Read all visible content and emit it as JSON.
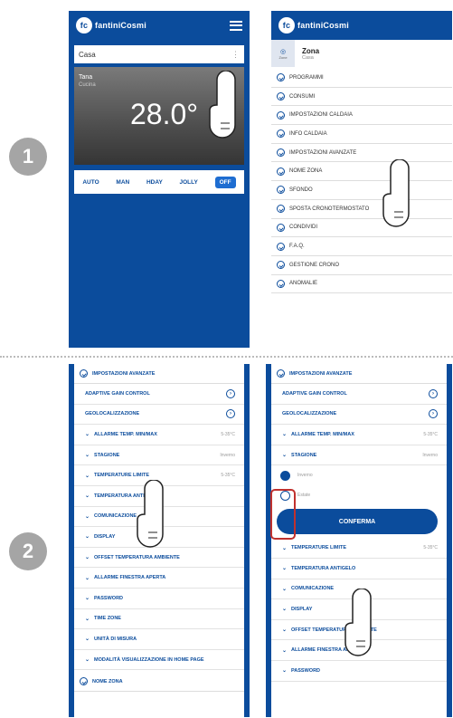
{
  "steps": [
    "1",
    "2"
  ],
  "phone1": {
    "logo": "fantiniCosmi",
    "casa": "Casa",
    "room_name": "Tana",
    "room_sub": "Cucina",
    "temperature": "28.0°",
    "modes": [
      "AUTO",
      "MAN",
      "HDAY",
      "JOLLY",
      "OFF"
    ]
  },
  "phone2": {
    "logo": "fantiniCosmi",
    "zone_btn": "Zone",
    "zone_title": "Zona",
    "zone_sub": "Casa",
    "menu": [
      "PROGRAMMI",
      "CONSUMI",
      "IMPOSTAZIONI CALDAIA",
      "INFO CALDAIA",
      "IMPOSTAZIONI AVANZATE",
      "NOME ZONA",
      "SFONDO",
      "SPOSTA CRONOTERMOSTATO",
      "CONDIVIDI",
      "F.A.Q.",
      "GESTIONE CRONO",
      "ANOMALIE"
    ]
  },
  "phone3": {
    "header": "IMPOSTAZIONI AVANZATE",
    "rows": [
      {
        "label": "ADAPTIVE GAIN CONTROL",
        "value": "",
        "circle": true
      },
      {
        "label": "GEOLOCALIZZAZIONE",
        "value": "",
        "circle": true
      },
      {
        "label": "ALLARME TEMP. MIN/MAX",
        "value": "5-35°C",
        "circle": false
      },
      {
        "label": "STAGIONE",
        "value": "Inverno",
        "circle": false
      },
      {
        "label": "TEMPERATURE LIMITE",
        "value": "5-35°C",
        "circle": false
      },
      {
        "label": "TEMPERATURA ANTIGELO",
        "value": "",
        "circle": false
      },
      {
        "label": "COMUNICAZIONE",
        "value": "",
        "circle": false
      },
      {
        "label": "DISPLAY",
        "value": "",
        "circle": false
      },
      {
        "label": "OFFSET TEMPERATURA AMBIENTE",
        "value": "",
        "circle": false
      },
      {
        "label": "ALLARME FINESTRA APERTA",
        "value": "",
        "circle": false
      },
      {
        "label": "PASSWORD",
        "value": "",
        "circle": false
      },
      {
        "label": "TIME ZONE",
        "value": "",
        "circle": false
      },
      {
        "label": "UNITÀ DI MISURA",
        "value": "",
        "circle": false
      },
      {
        "label": "MODALITÀ VISUALIZZAZIONE IN HOME PAGE",
        "value": "",
        "circle": false
      }
    ],
    "footer": "NOME ZONA"
  },
  "phone4": {
    "header": "IMPOSTAZIONI AVANZATE",
    "rows_top": [
      {
        "label": "ADAPTIVE GAIN CONTROL",
        "value": "",
        "circle": true
      },
      {
        "label": "GEOLOCALIZZAZIONE",
        "value": "",
        "circle": true
      },
      {
        "label": "ALLARME TEMP. MIN/MAX",
        "value": "5-35°C",
        "circle": false
      },
      {
        "label": "STAGIONE",
        "value": "Inverno",
        "circle": false
      }
    ],
    "radios": [
      {
        "label": "Inverno",
        "selected": true
      },
      {
        "label": "Estate",
        "selected": false
      }
    ],
    "confirm": "CONFERMA",
    "rows_bottom": [
      {
        "label": "TEMPERATURE LIMITE",
        "value": "5-35°C"
      },
      {
        "label": "TEMPERATURA ANTIGELO",
        "value": ""
      },
      {
        "label": "COMUNICAZIONE",
        "value": ""
      },
      {
        "label": "DISPLAY",
        "value": ""
      },
      {
        "label": "OFFSET TEMPERATURA AMBIENTE",
        "value": ""
      },
      {
        "label": "ALLARME FINESTRA APERTA",
        "value": ""
      },
      {
        "label": "PASSWORD",
        "value": ""
      }
    ]
  },
  "colors": {
    "brand": "#0b4c9c",
    "highlight": "#c0312e"
  },
  "icons": [
    "hamburger-icon",
    "check-circle-icon",
    "chevron-down-icon",
    "arrow-right-circle-icon",
    "finger-tap-icon"
  ]
}
